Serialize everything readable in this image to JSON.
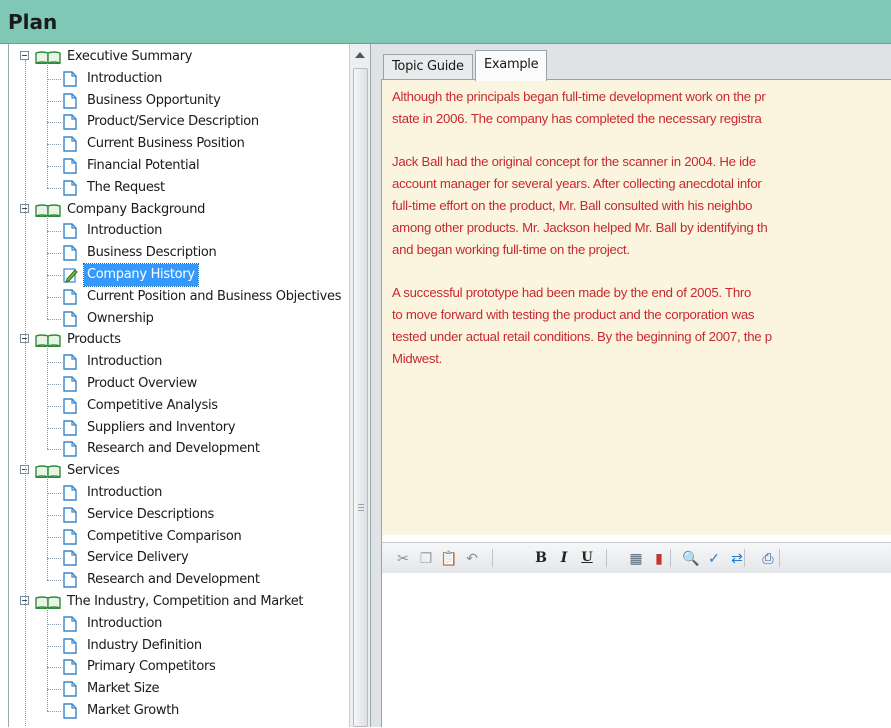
{
  "window": {
    "title": "Plan"
  },
  "tree": [
    {
      "label": "Executive Summary",
      "children": [
        {
          "label": "Introduction"
        },
        {
          "label": "Business Opportunity"
        },
        {
          "label": "Product/Service Description"
        },
        {
          "label": "Current Business Position"
        },
        {
          "label": "Financial Potential"
        },
        {
          "label": "The Request"
        }
      ]
    },
    {
      "label": "Company Background",
      "children": [
        {
          "label": "Introduction"
        },
        {
          "label": "Business Description"
        },
        {
          "label": "Company History",
          "selected": true
        },
        {
          "label": "Current Position and Business Objectives"
        },
        {
          "label": "Ownership"
        }
      ]
    },
    {
      "label": "Products",
      "children": [
        {
          "label": "Introduction"
        },
        {
          "label": "Product Overview"
        },
        {
          "label": "Competitive Analysis"
        },
        {
          "label": "Suppliers and Inventory"
        },
        {
          "label": "Research and Development"
        }
      ]
    },
    {
      "label": "Services",
      "children": [
        {
          "label": "Introduction"
        },
        {
          "label": "Service Descriptions"
        },
        {
          "label": "Competitive Comparison"
        },
        {
          "label": "Service Delivery"
        },
        {
          "label": "Research and Development"
        }
      ]
    },
    {
      "label": "The Industry, Competition and Market",
      "children": [
        {
          "label": "Introduction"
        },
        {
          "label": "Industry Definition"
        },
        {
          "label": "Primary Competitors"
        },
        {
          "label": "Market Size"
        },
        {
          "label": "Market Growth"
        }
      ]
    }
  ],
  "tabs": [
    {
      "label": "Topic Guide",
      "active": false
    },
    {
      "label": "Example",
      "active": true
    }
  ],
  "example_paragraphs": [
    [
      "Although the principals began full-time development work on the pr",
      "state in 2006. The company has completed the necessary registra"
    ],
    [
      "Jack Ball had the original concept for the scanner in 2004. He ide",
      "account manager for several years. After collecting anecdotal infor",
      "full-time effort on the product, Mr. Ball consulted with his neighbo",
      "among other products. Mr. Jackson helped Mr. Ball by identifying th",
      "and began working full-time on the project."
    ],
    [
      "A successful prototype had been made by the end of 2005. Thro",
      "to move forward with testing the product and the corporation was",
      "tested under actual retail conditions. By the beginning of 2007, the p",
      "Midwest."
    ]
  ],
  "toolbar": {
    "buttons": [
      {
        "name": "cut-icon",
        "glyph": "✂"
      },
      {
        "name": "copy-icon",
        "glyph": "❐"
      },
      {
        "name": "paste-icon",
        "glyph": "📋"
      },
      {
        "name": "undo-icon",
        "glyph": "↶"
      },
      {
        "name": "bold-button",
        "glyph": "B"
      },
      {
        "name": "italic-button",
        "glyph": "I"
      },
      {
        "name": "underline-button",
        "glyph": "U"
      },
      {
        "name": "table-icon",
        "glyph": "▦"
      },
      {
        "name": "chart-icon",
        "glyph": "▮"
      },
      {
        "name": "find-icon",
        "glyph": "🔍"
      },
      {
        "name": "spellcheck-icon",
        "glyph": "✓"
      },
      {
        "name": "replace-icon",
        "glyph": "⇄"
      },
      {
        "name": "print-icon",
        "glyph": "⎙"
      }
    ]
  },
  "colors": {
    "titlebar": "#7fc8b6",
    "example_text": "#c8282e",
    "example_background": "#fbf5e0",
    "selection": "#3399ff"
  }
}
